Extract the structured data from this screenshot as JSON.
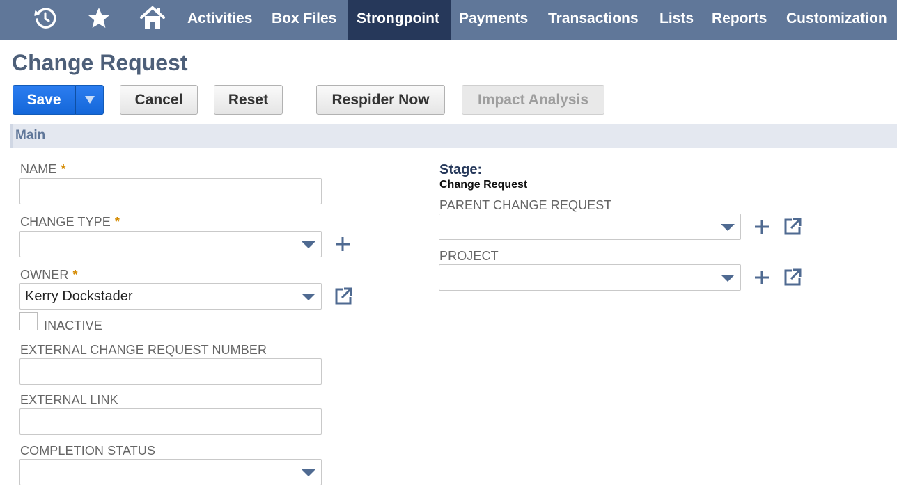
{
  "nav": {
    "icons": [
      "recent-icon",
      "star-icon",
      "home-icon"
    ],
    "items": [
      "Activities",
      "Box Files",
      "Strongpoint",
      "Payments",
      "Transactions",
      "Lists",
      "Reports",
      "Customization"
    ],
    "active": "Strongpoint",
    "colors": {
      "bar": "#607799",
      "active": "#26385a"
    }
  },
  "page": {
    "title": "Change Request"
  },
  "toolbar": {
    "save": "Save",
    "cancel": "Cancel",
    "reset": "Reset",
    "respider": "Respider Now",
    "impact": "Impact Analysis"
  },
  "section": {
    "main": "Main"
  },
  "fields": {
    "name": {
      "label": "NAME",
      "required": "*",
      "value": ""
    },
    "change_type": {
      "label": "CHANGE TYPE",
      "required": "*",
      "value": ""
    },
    "owner": {
      "label": "OWNER",
      "required": "*",
      "value": "Kerry Dockstader"
    },
    "inactive": {
      "label": "INACTIVE",
      "checked": false
    },
    "external_number": {
      "label": "EXTERNAL CHANGE REQUEST NUMBER",
      "value": ""
    },
    "external_link": {
      "label": "EXTERNAL LINK",
      "value": ""
    },
    "completion_status": {
      "label": "COMPLETION STATUS",
      "value": ""
    },
    "stage": {
      "label": "Stage:",
      "value": "Change Request"
    },
    "parent_change_request": {
      "label": "PARENT CHANGE REQUEST",
      "value": ""
    },
    "project": {
      "label": "PROJECT",
      "value": ""
    }
  },
  "colors": {
    "primary": "#1a6fe0",
    "label": "#666666",
    "required": "#d48a00",
    "heading": "#4d5f79"
  }
}
